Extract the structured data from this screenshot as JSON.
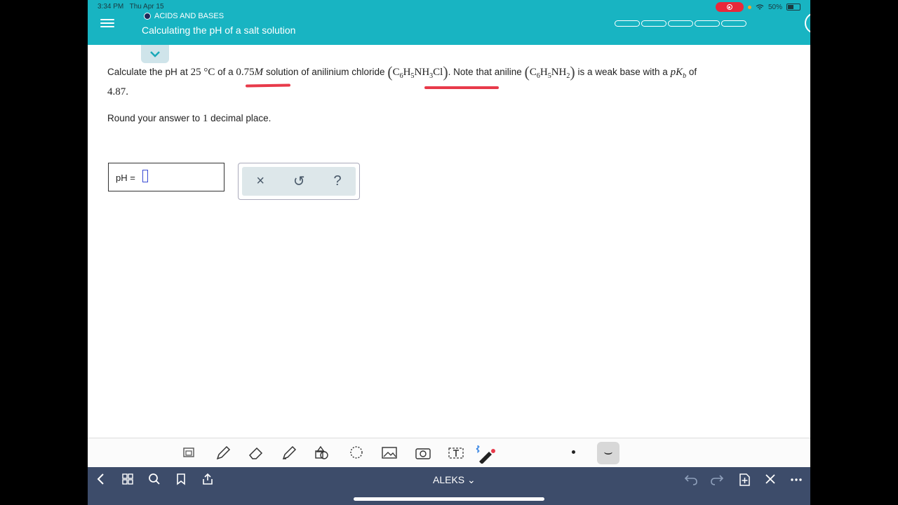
{
  "status": {
    "time": "3:34 PM",
    "date": "Thu Apr 15",
    "battery": "50%"
  },
  "header": {
    "topic": "ACIDS AND BASES",
    "title": "Calculating the pH of a salt solution",
    "progress_segments": 5
  },
  "question": {
    "p1": "Calculate the pH at",
    "temp": "25 °C",
    "p2": "of a",
    "conc": "0.75",
    "conc_unit": "M",
    "p3": "solution of anilinium chloride",
    "salt": {
      "c": "C",
      "c_sub": "6",
      "h": "H",
      "h_sub": "5",
      "nh": "NH",
      "nh_sub": "3",
      "cl": "Cl"
    },
    "p4": ". Note that aniline",
    "base": {
      "c": "C",
      "c_sub": "6",
      "h": "H",
      "h_sub": "5",
      "nh": "NH",
      "nh_sub": "2"
    },
    "p5": "is a weak base with a",
    "pk": "pK",
    "pk_sub": "b",
    "p6": "of",
    "pk_value": "4.87.",
    "round_a": "Round your answer to",
    "round_n": "1",
    "round_b": "decimal place."
  },
  "answer": {
    "label": "pH ="
  },
  "tools": {
    "clear": "×",
    "undo": "↺",
    "help": "?"
  },
  "nav": {
    "title": "ALEKS ⌄"
  },
  "icons": [
    "menu-icon",
    "chevron-down-icon",
    "pencil-icon",
    "eraser-icon",
    "highlighter-icon",
    "shapes-icon",
    "lasso-icon",
    "image-icon",
    "camera-icon",
    "text-icon",
    "bluetooth-icon",
    "back-icon",
    "grid-icon",
    "search-icon",
    "bookmark-icon",
    "share-icon",
    "undo-icon",
    "redo-icon",
    "add-page-icon",
    "close-icon",
    "more-icon"
  ]
}
